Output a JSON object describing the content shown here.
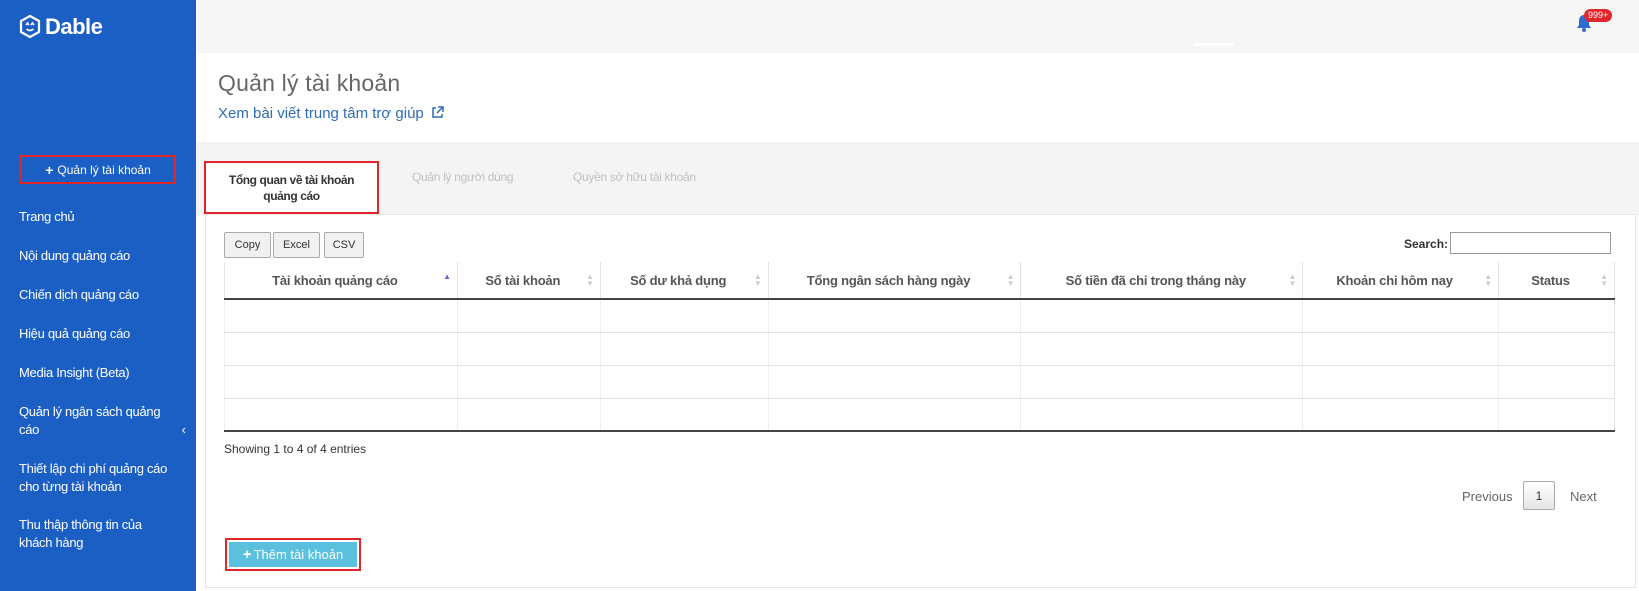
{
  "sidebar": {
    "brand": "Dable",
    "add_account_label": "Quản lý tài khoản",
    "items": [
      "Trang chủ",
      "Nội dung quảng cáo",
      "Chiến dịch quảng cáo",
      "Hiệu quả quảng cáo",
      "Media Insight (Beta)",
      "Quản lý ngân sách quảng cáo",
      "Thiết lập chi phí quảng cáo cho từng tài khoản",
      "Thu thập thông tin của khách hàng"
    ]
  },
  "header": {
    "notification_badge": "999+"
  },
  "page": {
    "title": "Quản lý tài khoản",
    "help_link": "Xem bài viết trung tâm trợ giúp"
  },
  "tabs": [
    "Tổng quan về tài khoản quảng cáo",
    "Quản lý người dùng",
    "Quyền sở hữu tài khoản"
  ],
  "toolbar": {
    "copy": "Copy",
    "excel": "Excel",
    "csv": "CSV",
    "search_label": "Search:",
    "search_value": ""
  },
  "table": {
    "columns": [
      "Tài khoản quảng cáo",
      "Số tài khoản",
      "Số dư khả dụng",
      "Tổng ngân sách hàng ngày",
      "Số tiền đã chi trong tháng này",
      "Khoản chi hôm nay",
      "Status"
    ],
    "rows": [
      [
        "",
        "",
        "",
        "",
        "",
        "",
        ""
      ],
      [
        "",
        "",
        "",
        "",
        "",
        "",
        ""
      ],
      [
        "",
        "",
        "",
        "",
        "",
        "",
        ""
      ],
      [
        "",
        "",
        "",
        "",
        "",
        "",
        ""
      ]
    ],
    "info": "Showing 1 to 4 of 4 entries"
  },
  "pagination": {
    "previous": "Previous",
    "page": "1",
    "next": "Next"
  },
  "add_account_button": "Thêm tài khoản",
  "colors": {
    "sidebar": "#1c5fc4",
    "highlight": "#e0252b",
    "add_button": "#5bc0de",
    "link": "#2f6bb7"
  }
}
